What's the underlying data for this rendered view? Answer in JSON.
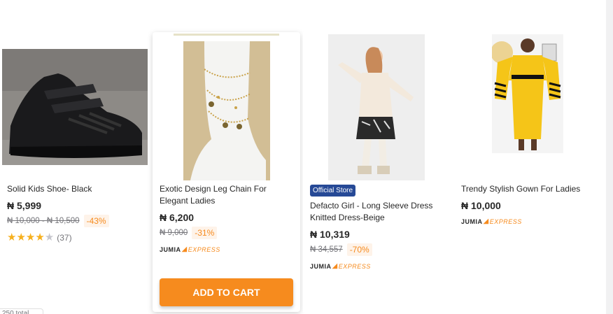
{
  "products": [
    {
      "name": "Solid Kids Shoe- Black",
      "price": "₦ 5,999",
      "old_price": "₦ 10,000 - ₦ 10,500",
      "discount": "-43%",
      "rating": 4,
      "reviews": "(37)"
    },
    {
      "name": "Exotic Design Leg Chain For Elegant Ladies",
      "price": "₦ 6,200",
      "old_price": "₦ 9,000",
      "discount": "-31%",
      "express_brand": "JUMIA",
      "express_label": "EXPRESS",
      "cart_label": "ADD TO CART"
    },
    {
      "badge": "Official Store",
      "name": "Defacto Girl - Long Sleeve Dress Knitted Dress-Beige",
      "price": "₦ 10,319",
      "old_price": "₦ 34,557",
      "discount": "-70%",
      "express_brand": "JUMIA",
      "express_label": "EXPRESS"
    },
    {
      "name": "Trendy Stylish Gown For Ladies",
      "price": "₦ 10,000",
      "express_brand": "JUMIA",
      "express_label": "EXPRESS"
    }
  ],
  "colors": {
    "accent": "#f68b1e",
    "badge": "#264996",
    "star": "#f6b01e"
  },
  "bottom_chip": "250 total"
}
